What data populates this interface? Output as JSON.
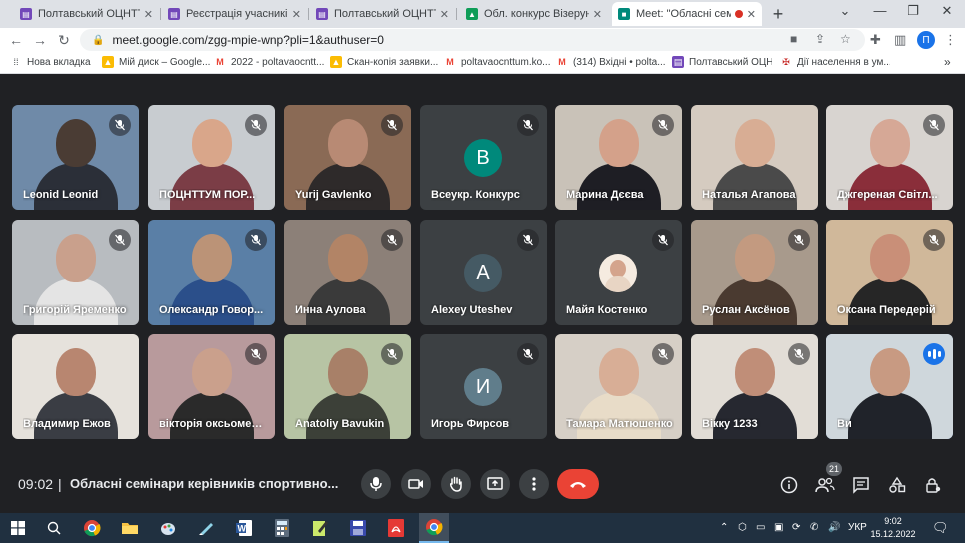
{
  "browser": {
    "tabs": [
      {
        "label": "Полтавський ОЦНТТУМ",
        "favicon": "forms-icon",
        "color": "#7248b9"
      },
      {
        "label": "Реєстрація учасників об",
        "favicon": "forms-icon",
        "color": "#7248b9"
      },
      {
        "label": "Полтавський ОЦНТТУМ",
        "favicon": "forms-icon",
        "color": "#7248b9"
      },
      {
        "label": "Обл. конкурс Візерунки",
        "favicon": "drive-icon",
        "color": "#0f9d58"
      },
      {
        "label": "Meet: \"Обласні семі",
        "favicon": "meet-icon",
        "color": "#00897b"
      }
    ],
    "new_tab": "+",
    "url": "meet.google.com/zgg-mpie-wnp?pli=1&authuser=0",
    "profile_initial": "П",
    "bookmarks": [
      {
        "label": "Нова вкладка",
        "icon": "apps-icon"
      },
      {
        "label": "Мій диск – Google...",
        "icon": "drive-icon"
      },
      {
        "label": "2022 - poltavaocntt...",
        "icon": "gmail-icon"
      },
      {
        "label": "Скан-копія заявки...",
        "icon": "drive-icon"
      },
      {
        "label": "poltavaocnttum.ko...",
        "icon": "gmail-icon"
      },
      {
        "label": "(314) Вхідні • polta...",
        "icon": "gmail-icon"
      },
      {
        "label": "Полтавський ОЦН...",
        "icon": "forms-icon"
      },
      {
        "label": "Дії населення в ум...",
        "icon": "emblem-icon"
      }
    ],
    "bookmarks_more": "»"
  },
  "participants": [
    {
      "name": "Leonid Leonid",
      "type": "video",
      "bg": "#6f8aa8",
      "skin": "#4a3c34",
      "cloth": "#2b2f38",
      "muted": true
    },
    {
      "name": "ПОЦНТТУМ ПОР...",
      "type": "video",
      "bg": "#c8ccd0",
      "skin": "#d9a68a",
      "cloth": "#7b3d46",
      "muted": true
    },
    {
      "name": "Yurij Gavlenko",
      "type": "video",
      "bg": "#8a6a55",
      "skin": "#b88a74",
      "cloth": "#2e2a2a",
      "muted": true
    },
    {
      "name": "Всеукр. Конкурс",
      "type": "avatar",
      "initial": "В",
      "color": "#00897b",
      "muted": true
    },
    {
      "name": "Марина Дєєва",
      "type": "video",
      "bg": "#c9c2b8",
      "skin": "#d4a18a",
      "cloth": "#1e1e24",
      "muted": true
    },
    {
      "name": "Наталья Агапова",
      "type": "video",
      "bg": "#d5cbc0",
      "skin": "#d8ad94",
      "cloth": "#4a4a4a",
      "muted": false
    },
    {
      "name": "Джгереная Світл...",
      "type": "video",
      "bg": "#d8d4d0",
      "skin": "#d6a896",
      "cloth": "#8a2e3a",
      "muted": true
    },
    {
      "name": "Григорій Яременко",
      "type": "video",
      "bg": "#b8bcc0",
      "skin": "#c9a08c",
      "cloth": "#e4e4e4",
      "muted": true
    },
    {
      "name": "Олександр Говор...",
      "type": "video",
      "bg": "#5a7fa6",
      "skin": "#bb9377",
      "cloth": "#2b4f8a",
      "muted": true
    },
    {
      "name": "Инна Аулова",
      "type": "video",
      "bg": "#8c8078",
      "skin": "#b28466",
      "cloth": "#3a3a3a",
      "muted": true
    },
    {
      "name": "Alexey Uteshev",
      "type": "avatar",
      "initial": "A",
      "color": "#455a64",
      "muted": true
    },
    {
      "name": "Майя Костенко",
      "type": "mini",
      "muted": true
    },
    {
      "name": "Руслан Аксёнов",
      "type": "video",
      "bg": "#a89a8c",
      "skin": "#c39a80",
      "cloth": "#4a3a30",
      "muted": true
    },
    {
      "name": "Оксана Передерій",
      "type": "video",
      "bg": "#d0b89a",
      "skin": "#c98f78",
      "cloth": "#262626",
      "muted": true
    },
    {
      "name": "Владимир Ежов",
      "type": "video",
      "bg": "#e6e2dc",
      "skin": "#b88670",
      "cloth": "#3a3d44",
      "muted": false
    },
    {
      "name": "вікторія оксьомен...",
      "type": "video",
      "bg": "#b89a9c",
      "skin": "#caa08c",
      "cloth": "#2a2a2a",
      "muted": true
    },
    {
      "name": "Anatoliy Bavukin",
      "type": "video",
      "bg": "#b7c4a4",
      "skin": "#a88068",
      "cloth": "#3c4038",
      "muted": true
    },
    {
      "name": "Игорь Фирсов",
      "type": "avatar",
      "initial": "И",
      "color": "#607d8b",
      "muted": true
    },
    {
      "name": "Тамара Матюшенко",
      "type": "video",
      "bg": "#d6cfc6",
      "skin": "#d8ae96",
      "cloth": "#e8dcc8",
      "muted": true
    },
    {
      "name": "Вікку 1233",
      "type": "video",
      "bg": "#e2ddd6",
      "skin": "#c08e78",
      "cloth": "#262830",
      "muted": true
    },
    {
      "name": "Ви",
      "type": "video",
      "bg": "#cfd7dc",
      "skin": "#c89a82",
      "cloth": "#20232a",
      "muted": false,
      "speaking": true
    }
  ],
  "meeting": {
    "time": "09:02",
    "separator": "|",
    "title": "Обласні семінари керівників спортивно...",
    "participant_count": "21"
  },
  "controls": {
    "mic": "mic-icon",
    "camera": "camera-icon",
    "raise_hand": "hand-icon",
    "present": "present-icon",
    "more": "more-vert-icon",
    "end_call": "end-call-icon"
  },
  "taskbar": {
    "language": "УКР",
    "time": "9:02",
    "date": "15.12.2022"
  }
}
